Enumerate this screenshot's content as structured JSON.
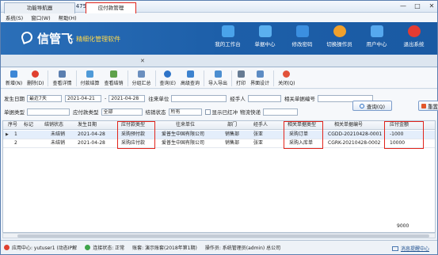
{
  "window": {
    "title": "信管飞RMS专业版 V9.2.475",
    "controls": [
      "—",
      "□",
      "✕"
    ]
  },
  "menu": [
    "系统(S)",
    "窗口(W)",
    "帮助(H)"
  ],
  "banner": {
    "logo": "信管飞",
    "slogan": "· 精细化管理软件",
    "nav": [
      {
        "label": "我的工作台",
        "icon": "monitor-icon",
        "color": "#4aa3ea"
      },
      {
        "label": "单据中心",
        "icon": "document-list-icon",
        "color": "#5bb0ef"
      },
      {
        "label": "修改密码",
        "icon": "key-icon",
        "color": "#3b8fe0"
      },
      {
        "label": "切换操作员",
        "icon": "switch-user-icon",
        "color": "#f0a02c"
      },
      {
        "label": "用户中心",
        "icon": "users-icon",
        "color": "#56a8ee"
      },
      {
        "label": "退出系统",
        "icon": "power-icon",
        "color": "#e43b32"
      }
    ]
  },
  "tabs": [
    {
      "label": "功能导航器",
      "active": false
    },
    {
      "label": "应付款管理",
      "active": true
    }
  ],
  "toolbar": [
    {
      "label": "新增(N)",
      "icon": "new-icon",
      "color": "#3d87d6"
    },
    {
      "label": "删除(D)",
      "icon": "delete-icon",
      "color": "#e0402f"
    },
    {
      "label": "查看详情",
      "icon": "view-icon",
      "color": "#5b7fb0"
    },
    {
      "label": "付款结算",
      "icon": "payment-icon",
      "color": "#4f9ad8"
    },
    {
      "label": "查看结销",
      "icon": "settle-view-icon",
      "color": "#5ea14a"
    },
    {
      "label": "分组汇总",
      "icon": "group-icon",
      "color": "#6b8fbf"
    },
    {
      "label": "查询(E)",
      "icon": "query-icon",
      "color": "#2f74c8"
    },
    {
      "label": "高级查询",
      "icon": "advanced-query-icon",
      "color": "#3d83cf"
    },
    {
      "label": "导入导出",
      "icon": "import-export-icon",
      "color": "#4c8ed0"
    },
    {
      "label": "打印",
      "icon": "print-icon",
      "color": "#667b93"
    },
    {
      "label": "界面设计",
      "icon": "design-icon",
      "color": "#5d8cc4"
    },
    {
      "label": "关闭(Q)",
      "icon": "close-icon",
      "color": "#e2523a"
    }
  ],
  "filters": {
    "date_label": "发生日期",
    "date_range": "最近7天",
    "date_from": "2021-04-21",
    "date_to": "2021-04-28",
    "unit_label": "往来单位",
    "unit_value": "",
    "handler_label": "经手人",
    "handler_value": "",
    "ref_no_label": "相关单据编号",
    "ref_no_value": "",
    "doc_type_label": "单据类型",
    "doc_type_value": "",
    "ap_type_label": "应付款类型",
    "ap_type_value": "全部",
    "settle_label": "结销状态",
    "settle_value": "所有",
    "show_red_label": "显示已红冲",
    "logistics_label": "物流快递",
    "logistics_value": "",
    "query_button": "查询(Q)",
    "reset_button": "重置"
  },
  "table": {
    "headers": [
      "序号",
      "标记",
      "结销状态",
      "发生日期",
      "应付款类型",
      "往来单位",
      "部门",
      "经手人",
      "相关单据类型",
      "相关单据编号",
      "应付金额"
    ],
    "rows": [
      [
        "1",
        "",
        "未结销",
        "2021-04-28",
        "采购预付款",
        "爱普生中国有限公司",
        "销售部",
        "张亚",
        "采购订单",
        "CGDD-20210428-0001",
        "-1000"
      ],
      [
        "2",
        "",
        "未结销",
        "2021-04-28",
        "采购应付款",
        "爱普生中国有限公司",
        "销售部",
        "张亚",
        "采购入库单",
        "CGRK-20210428-0002",
        "10000"
      ]
    ],
    "total_amount": "9000"
  },
  "status": {
    "app_center": "应用中心: yutuser1 (动态IP解",
    "connection": "连接状态: 正常",
    "account": "账套: 演示账套(2018年第1期)",
    "operator": "操作员: 系统管理员(admin) 总公司",
    "message": "消息提醒中心"
  },
  "colors": {
    "banner": "#1d5fa9",
    "highlight": "#e2231a",
    "selected_row": "#e4eefb"
  }
}
